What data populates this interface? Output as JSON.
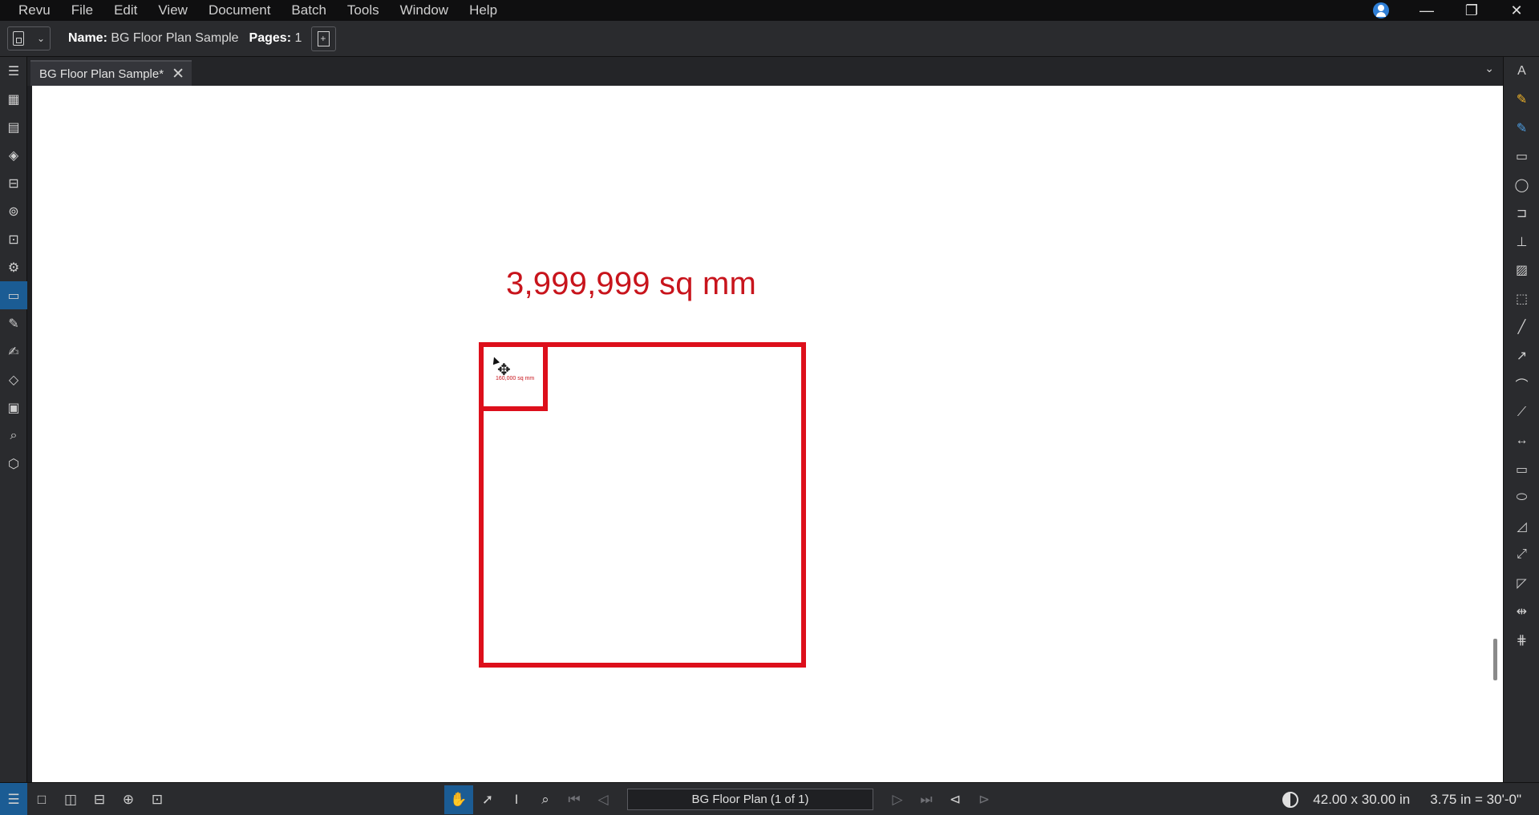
{
  "menubar": {
    "items": [
      "Revu",
      "File",
      "Edit",
      "View",
      "Document",
      "Batch",
      "Tools",
      "Window",
      "Help"
    ],
    "window_controls": {
      "minimize": "—",
      "restore": "❐",
      "close": "✕"
    }
  },
  "doc_toolbar": {
    "name_label": "Name:",
    "name_value": "BG Floor Plan Sample",
    "pages_label": "Pages:",
    "pages_value": "1"
  },
  "tabs": [
    {
      "label": "BG Floor Plan Sample*",
      "active": true
    }
  ],
  "canvas": {
    "large_measurement": "3,999,999 sq mm",
    "small_measurement": "160,000 sq mm",
    "markup_color": "#dd0f1b"
  },
  "status_bar": {
    "page_label": "BG Floor Plan (1 of 1)",
    "page_size": "42.00 x 30.00 in",
    "scale": "3.75 in = 30'-0\""
  },
  "colors": {
    "accent": "#1b5c94",
    "background": "#2a2b2e",
    "menubar": "#0f0f10"
  },
  "left_tools": [
    "thumbnails-icon",
    "bookmarks-icon",
    "file-access-icon",
    "layers-icon",
    "toolchest-icon",
    "places-icon",
    "sets-icon",
    "properties-icon",
    "measurements-icon",
    "markups-list-icon",
    "signatures-icon",
    "tags-icon",
    "print-icon",
    "search-icon",
    "spaces-icon"
  ],
  "right_tools": [
    "text-box-icon",
    "highlight-icon",
    "pen-icon",
    "callout-icon",
    "cloud-icon",
    "callout-arrow-icon",
    "stamp-icon",
    "image-icon",
    "snapshot-icon",
    "line-icon",
    "arrow-icon",
    "arc-icon",
    "polyline-icon",
    "dimension-icon",
    "rectangle-icon",
    "ellipse-icon",
    "polygon-icon",
    "measure-length-icon",
    "measure-area-icon",
    "measure-distance-icon",
    "count-icon"
  ]
}
